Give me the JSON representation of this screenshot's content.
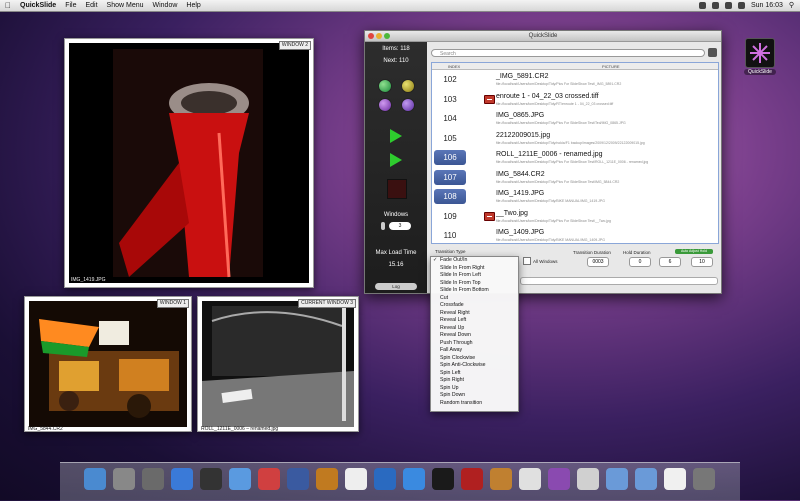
{
  "menubar": {
    "menus": [
      "QuickSlide",
      "File",
      "Edit",
      "Show Menu",
      "Window",
      "Help"
    ],
    "clock": "Sun 16:03"
  },
  "photo_windows": [
    {
      "tag": "WINDOW 2",
      "caption": "IMG_1419.JPG"
    },
    {
      "tag": "WINDOW 1",
      "caption": "IMG_5844.CR2"
    },
    {
      "tag": "CURRENT WINDOW 3",
      "caption": "ROLL_1211E_0006 – renamed.jpg"
    }
  ],
  "app": {
    "title": "QuickSlide",
    "items_label": "Items: 118",
    "next_label": "Next: 110",
    "windows_label": "Windows",
    "windows_value": "3",
    "max_load_label": "Max Load Time",
    "max_load_value": "15.16",
    "log_label": "Log",
    "search_placeholder": "Search",
    "columns": {
      "index": "INDEX",
      "picture": "PICTURE"
    },
    "rows": [
      {
        "index": "102",
        "name": "_IMG_5891.CR2",
        "path": "file://localhost/Users/tom/Desktop/Tidy/Pics For SlideShow Test/_IMG_5891.CR2",
        "selected": false,
        "thumb": false
      },
      {
        "index": "103",
        "name": "enroute 1 - 04_22_03 crossed.tiff",
        "path": "file://localhost/Users/tom/Desktop/Tidy/RT/enroute 1 - 04_22_03 crossed.tiff",
        "selected": false,
        "thumb": true
      },
      {
        "index": "104",
        "name": "IMG_0865.JPG",
        "path": "file://localhost/Users/tom/Desktop/Tidy/Pics For SlideShow Test/Ted/IMG_0865.JPG",
        "selected": false,
        "thumb": false
      },
      {
        "index": "105",
        "name": "22122009015.jpg",
        "path": "file://localhost/Users/tom/Desktop/Tidy/nokia/F1 backup/images/2009/12/2009/22122009015.jpg",
        "selected": false,
        "thumb": false
      },
      {
        "index": "106",
        "name": "ROLL_1211E_0006 - renamed.jpg",
        "path": "file://localhost/Users/tom/Desktop/Tidy/Pics For SlideShow Test/ROLL_1211E_0006 - renamed.jpg",
        "selected": true,
        "thumb": false
      },
      {
        "index": "107",
        "name": "IMG_5844.CR2",
        "path": "file://localhost/Users/tom/Desktop/Tidy/Pics For SlideShow Test/IMG_5844.CR2",
        "selected": true,
        "thumb": false
      },
      {
        "index": "108",
        "name": "IMG_1419.JPG",
        "path": "file://localhost/Users/tom/Desktop/Tidy/BIKE MANUAL/IMG_1419.JPG",
        "selected": true,
        "thumb": false
      },
      {
        "index": "109",
        "name": "__Two.jpg",
        "path": "file://localhost/Users/tom/Desktop/Tidy/Pics For SlideShow Test/__Two.jpg",
        "selected": false,
        "thumb": true
      },
      {
        "index": "110",
        "name": "IMG_1409.JPG",
        "path": "file://localhost/Users/tom/Desktop/Tidy/BIKE MANUAL/IMG_1409.JPG",
        "selected": false,
        "thumb": false
      }
    ],
    "transition_type_label": "Transition Type",
    "all_windows_label": "All Windows",
    "transition_duration_label": "Transition Duration",
    "transition_duration_value": "0003",
    "hold_duration_label": "Hold Duration",
    "hold_values": [
      "0",
      "6",
      "10"
    ],
    "auto_adjust_label": "Auto Adjust Hold"
  },
  "transition_menu": {
    "items": [
      "Fade Out/In",
      "Slide In From Right",
      "Slide In From Left",
      "Slide In From Top",
      "Slide In From Bottom",
      "Cut",
      "Crossfade",
      "Reveal Right",
      "Reveal Left",
      "Reveal Up",
      "Reveal Down",
      "Push Through",
      "Fall Away",
      "Spin Clockwise",
      "Spin Anti-Clockwise",
      "Spin Left",
      "Spin Right",
      "Spin Up",
      "Spin Down",
      "Random transition"
    ],
    "checked_index": 0
  },
  "desktop_icon": {
    "label": "QuickSlide"
  },
  "colors": {
    "accent": "#3b5694",
    "play_green": "#2ecc2e"
  }
}
